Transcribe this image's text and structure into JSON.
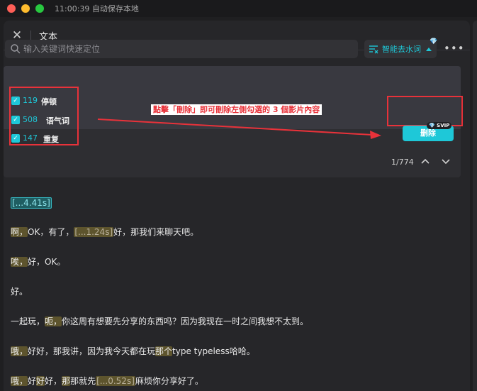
{
  "titlebar": {
    "status": "11:00:39 自动保存本地"
  },
  "header": {
    "title": "文本"
  },
  "search": {
    "placeholder": "输入关键词快速定位"
  },
  "smart_remove": {
    "label": "智能去水词"
  },
  "more": {
    "label": "•••"
  },
  "filters": [
    {
      "count": "119",
      "label": "停顿",
      "checked": true
    },
    {
      "count": "508",
      "label": "语气词",
      "checked": true
    },
    {
      "count": "147",
      "label": "重复",
      "checked": true
    }
  ],
  "annotation": {
    "text": "點擊「刪除」即可刪除左側勾選的 3 個影片內容"
  },
  "delete_button": {
    "label": "删除",
    "badge": "SVIP"
  },
  "pager": {
    "text": "1/774"
  },
  "transcript": {
    "l1": {
      "seg": "[...4.41s]"
    },
    "l2": {
      "a": "啊，",
      "b": "OK，有了，",
      "seg": "[...1.24s]",
      "c": "好，那我们来聊天吧。"
    },
    "l3": {
      "a": "唉，",
      "b": "好，OK。"
    },
    "l4": {
      "a": "好。"
    },
    "l5": {
      "a": "一起玩，",
      "b": "呃，",
      "c": "你这周有想要先分享的东西吗？因为我现在一时之间我想不太到。"
    },
    "l6": {
      "a": "哦，",
      "b": "好好，那我讲，因为我今天都在玩",
      "c": "那个",
      "d": "type typeless哈哈。"
    },
    "l7": {
      "a": "哦，",
      "b": "好",
      "c": "好",
      "d": "好，",
      "e": "那",
      "f": "那就先",
      "seg": "[...0.52s]",
      "g": "麻烦你分享好了。"
    }
  },
  "colors": {
    "accent": "#1ec8d8",
    "annotation_red": "#e8323a",
    "filler_highlight": "#5d542d"
  }
}
